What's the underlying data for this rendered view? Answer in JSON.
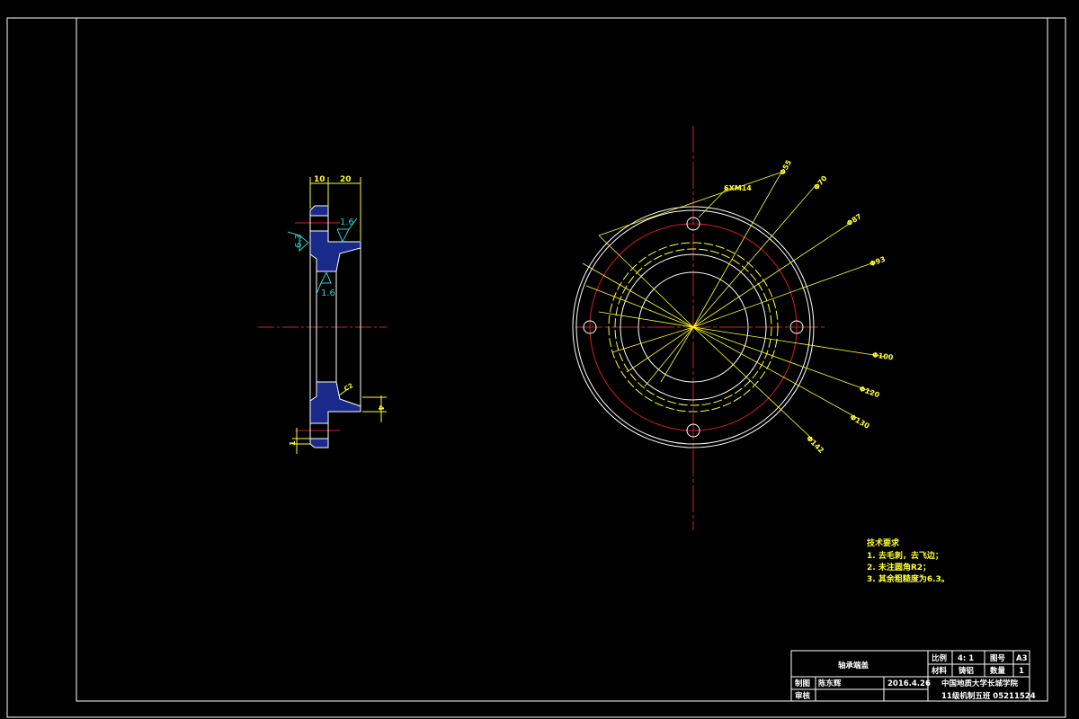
{
  "colors": {
    "background": "#000000",
    "outline": "#ffffff",
    "centerline": "#d42020",
    "dimension": "#ffff33",
    "roughness": "#33cccc",
    "hatch": "#1a2a8a"
  },
  "section_view": {
    "dims": {
      "width_flange": "10",
      "width_hub": "20",
      "small_step": "4",
      "bottom_step": "1",
      "chamfer": "C2"
    },
    "roughness": {
      "top": "1.6",
      "left": "6.3",
      "bore": "1.6"
    }
  },
  "front_view": {
    "labels": [
      "6XM14",
      "Φ55",
      "Φ70",
      "Φ87",
      "Φ93",
      "Φ100",
      "Φ120",
      "Φ130",
      "Φ142"
    ]
  },
  "tech_requirements": {
    "title": "技术要求",
    "items": [
      "1. 去毛刺，去飞边；",
      "2. 未注圆角R2；",
      "3. 其余粗糙度为6.3。"
    ]
  },
  "title_block": {
    "part_name": "轴承端盖",
    "scale_label": "比例",
    "scale_value": "4: 1",
    "drawing_no_label": "图号",
    "drawing_no_value": "A3",
    "material_label": "材料",
    "material_value": "铸铝",
    "quantity_label": "数量",
    "quantity_value": "1",
    "drawn_label": "制图",
    "drawn_by": "陈东辉",
    "date": "2016.4.26",
    "checked_label": "审核",
    "school": "中国地质大学长城学院",
    "class_id": "11级机制五班 05211524"
  }
}
